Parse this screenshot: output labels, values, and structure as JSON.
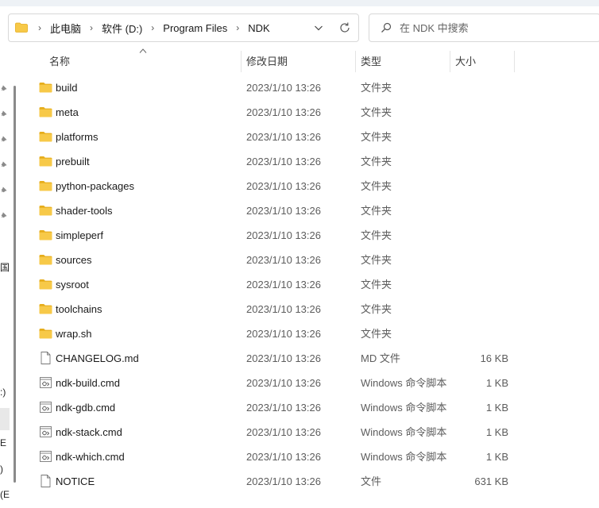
{
  "address": {
    "crumbs": [
      "此电脑",
      "软件 (D:)",
      "Program Files",
      "NDK"
    ]
  },
  "search": {
    "placeholder": "在 NDK 中搜索"
  },
  "columns": {
    "name": "名称",
    "date": "修改日期",
    "type": "类型",
    "size": "大小"
  },
  "nav_fragments": [
    "国",
    ":)",
    "E",
    ")",
    "(E"
  ],
  "files": [
    {
      "name": "build",
      "date": "2023/1/10 13:26",
      "type": "文件夹",
      "size": "",
      "icon": "folder-icon"
    },
    {
      "name": "meta",
      "date": "2023/1/10 13:26",
      "type": "文件夹",
      "size": "",
      "icon": "folder-icon"
    },
    {
      "name": "platforms",
      "date": "2023/1/10 13:26",
      "type": "文件夹",
      "size": "",
      "icon": "folder-icon"
    },
    {
      "name": "prebuilt",
      "date": "2023/1/10 13:26",
      "type": "文件夹",
      "size": "",
      "icon": "folder-icon"
    },
    {
      "name": "python-packages",
      "date": "2023/1/10 13:26",
      "type": "文件夹",
      "size": "",
      "icon": "folder-icon"
    },
    {
      "name": "shader-tools",
      "date": "2023/1/10 13:26",
      "type": "文件夹",
      "size": "",
      "icon": "folder-icon"
    },
    {
      "name": "simpleperf",
      "date": "2023/1/10 13:26",
      "type": "文件夹",
      "size": "",
      "icon": "folder-icon"
    },
    {
      "name": "sources",
      "date": "2023/1/10 13:26",
      "type": "文件夹",
      "size": "",
      "icon": "folder-icon"
    },
    {
      "name": "sysroot",
      "date": "2023/1/10 13:26",
      "type": "文件夹",
      "size": "",
      "icon": "folder-icon"
    },
    {
      "name": "toolchains",
      "date": "2023/1/10 13:26",
      "type": "文件夹",
      "size": "",
      "icon": "folder-icon"
    },
    {
      "name": "wrap.sh",
      "date": "2023/1/10 13:26",
      "type": "文件夹",
      "size": "",
      "icon": "folder-icon"
    },
    {
      "name": "CHANGELOG.md",
      "date": "2023/1/10 13:26",
      "type": "MD 文件",
      "size": "16 KB",
      "icon": "document-icon"
    },
    {
      "name": "ndk-build.cmd",
      "date": "2023/1/10 13:26",
      "type": "Windows 命令脚本",
      "size": "1 KB",
      "icon": "script-icon"
    },
    {
      "name": "ndk-gdb.cmd",
      "date": "2023/1/10 13:26",
      "type": "Windows 命令脚本",
      "size": "1 KB",
      "icon": "script-icon"
    },
    {
      "name": "ndk-stack.cmd",
      "date": "2023/1/10 13:26",
      "type": "Windows 命令脚本",
      "size": "1 KB",
      "icon": "script-icon"
    },
    {
      "name": "ndk-which.cmd",
      "date": "2023/1/10 13:26",
      "type": "Windows 命令脚本",
      "size": "1 KB",
      "icon": "script-icon"
    },
    {
      "name": "NOTICE",
      "date": "2023/1/10 13:26",
      "type": "文件",
      "size": "631 KB",
      "icon": "document-icon"
    }
  ],
  "colors": {
    "folder": "#f7c948",
    "folder_dark": "#e6ad1c",
    "border": "#d8d8d8",
    "muted_text": "#5d5d5d"
  }
}
